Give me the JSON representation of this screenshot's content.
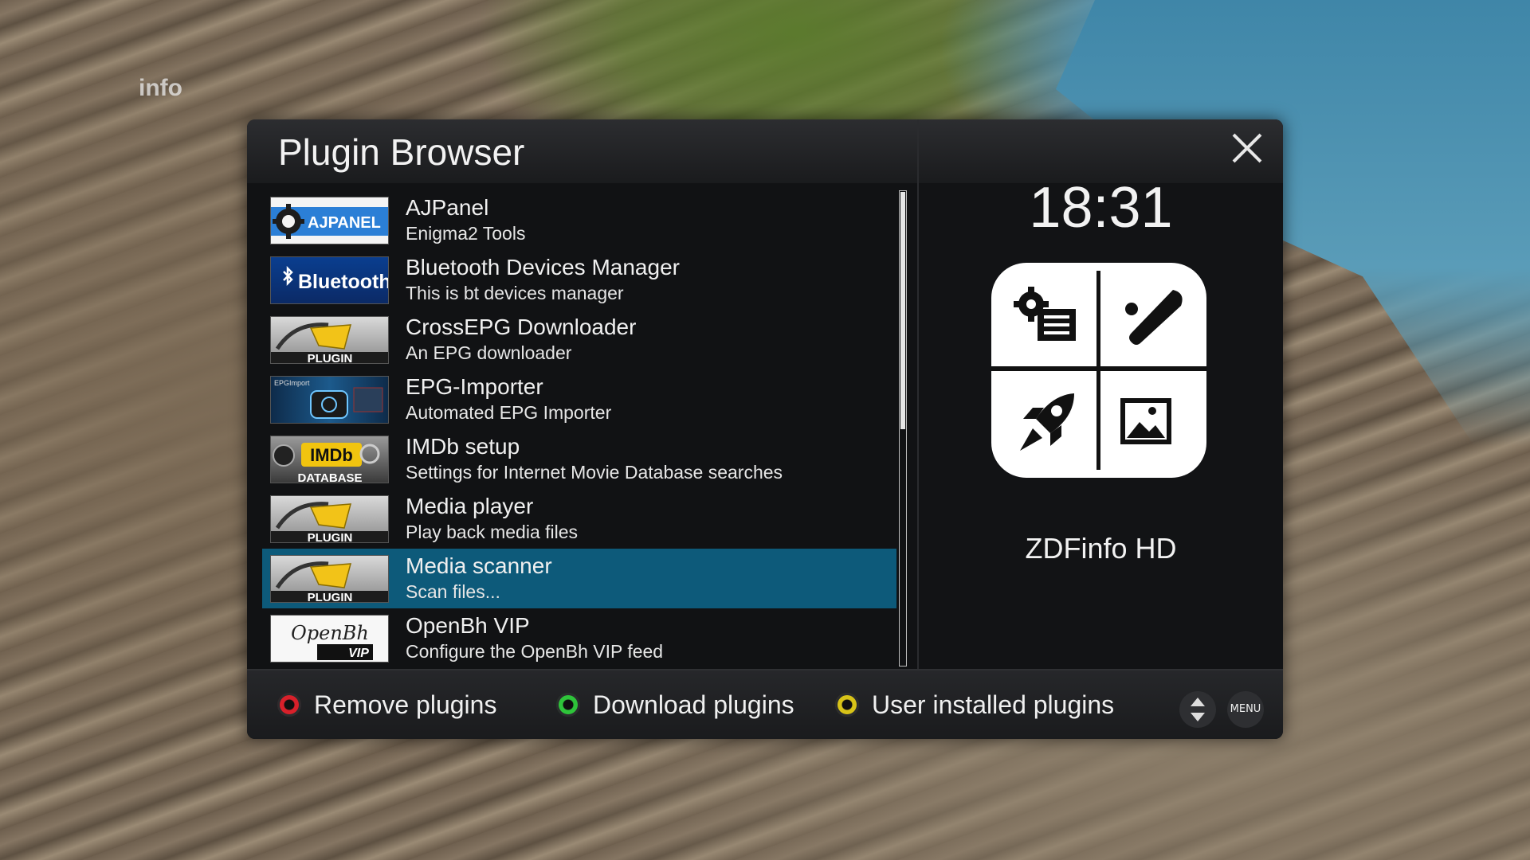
{
  "background": {
    "channel_logo": "info"
  },
  "dialog": {
    "title": "Plugin Browser",
    "plugins": [
      {
        "name": "AJPanel",
        "description": "Enigma2 Tools",
        "icon": "ajpanel-logo",
        "icon_text": "AJPANEL"
      },
      {
        "name": "Bluetooth Devices Manager",
        "description": "This is bt devices manager",
        "icon": "bluetooth-logo",
        "icon_text": "Bluetooth"
      },
      {
        "name": "CrossEPG Downloader",
        "description": "An EPG downloader",
        "icon": "generic-plugin-logo",
        "icon_text": "PLUGIN"
      },
      {
        "name": "EPG-Importer",
        "description": "Automated EPG Importer",
        "icon": "epgimport-logo",
        "icon_text": "EPGImport"
      },
      {
        "name": "IMDb setup",
        "description": "Settings for Internet Movie Database searches",
        "icon": "imdb-logo",
        "icon_text": "IMDb",
        "icon_subtext": "DATABASE"
      },
      {
        "name": "Media player",
        "description": "Play back media files",
        "icon": "generic-plugin-logo",
        "icon_text": "PLUGIN"
      },
      {
        "name": "Media scanner",
        "description": "Scan files...",
        "icon": "generic-plugin-logo",
        "icon_text": "PLUGIN",
        "selected": true
      },
      {
        "name": "OpenBh VIP",
        "description": "Configure the OpenBh VIP feed",
        "icon": "openbh-vip-logo",
        "icon_text": "OpenBh",
        "icon_subtext": "VIP"
      }
    ],
    "scroll": {
      "fraction_visible": 0.5,
      "position": 0
    },
    "side_panel": {
      "clock": "18:31",
      "tile_icons": [
        "gear-checklist-icon",
        "baseball-bat-icon",
        "rocket-icon",
        "picture-icon"
      ],
      "channel": "ZDFinfo HD"
    },
    "footer": {
      "red_label": "Remove plugins",
      "green_label": "Download plugins",
      "yellow_label": "User installed plugins",
      "menu_label": "MENU"
    },
    "colors": {
      "selection": "#0d5a7a",
      "red": "#d8202a",
      "green": "#2ec43a",
      "yellow": "#d8c318"
    }
  }
}
